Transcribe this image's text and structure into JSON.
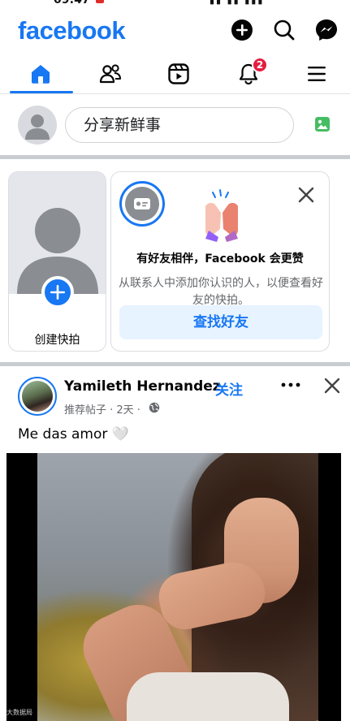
{
  "status_bar": {
    "time": "09:47",
    "signal": "▮▮ ▮▮ ▮▮▮"
  },
  "header": {
    "logo": "facebook"
  },
  "tabs": [
    {
      "name": "home",
      "active": true
    },
    {
      "name": "friends",
      "active": false
    },
    {
      "name": "reels",
      "active": false
    },
    {
      "name": "notifications",
      "active": false,
      "badge": "2"
    },
    {
      "name": "menu",
      "active": false
    }
  ],
  "composer": {
    "placeholder": "分享新鲜事"
  },
  "stories": {
    "create_label": "创建快拍",
    "suggest_heading": "有好友相伴，Facebook 会更赞",
    "suggest_desc": "从联系人中添加你认识的人，以便查看好友的快拍。",
    "find_friends_label": "查找好友"
  },
  "post": {
    "author": "Yamileth Hernandez",
    "dot": "·",
    "follow_label": "关注",
    "meta": "推荐帖子 · 2天 ·",
    "text": "Me das amor 🤍"
  },
  "watermark": "大数据局",
  "colors": {
    "brand": "#1877f2",
    "badge": "#e41e3f",
    "secondary_text": "#65676b"
  }
}
